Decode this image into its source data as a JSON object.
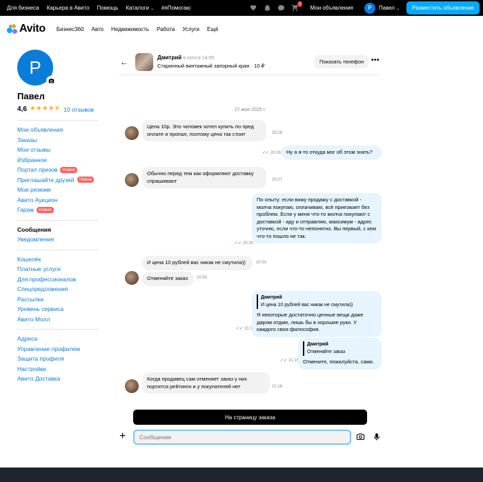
{
  "topbar": {
    "links": [
      "Для бизнеса",
      "Карьера в Авито",
      "Помощь",
      "Каталоги",
      "#яПомогаю"
    ],
    "cart_count": "2",
    "my_ads": "Мои объявления",
    "avatar_letter": "P",
    "username": "Павел",
    "post_button": "Разместить объявление"
  },
  "header": {
    "logo": "Avito",
    "nav": [
      "Бизнес360",
      "Авто",
      "Недвижимость",
      "Работа",
      "Услуги",
      "Ещё"
    ]
  },
  "profile": {
    "avatar_letter": "P",
    "name": "Павел",
    "rating": "4,6",
    "stars": "★★★★⯪",
    "reviews": "10 отзывов"
  },
  "menu_groups": [
    [
      {
        "label": "Мои объявления"
      },
      {
        "label": "Заказы"
      },
      {
        "label": "Мои отзывы"
      },
      {
        "label": "Избранное"
      },
      {
        "label": "Портал призов",
        "badge": "Новое"
      },
      {
        "label": "Приглашайте друзей",
        "badge": "Новое"
      },
      {
        "label": "Мои резюме"
      },
      {
        "label": "Авито Аукцион"
      },
      {
        "label": "Гараж",
        "badge": "Новое"
      }
    ],
    [
      {
        "label": "Сообщения",
        "active": true
      },
      {
        "label": "Уведомления"
      }
    ],
    [
      {
        "label": "Кошелёк"
      },
      {
        "label": "Платные услуги"
      },
      {
        "label": "Для профессионалов"
      },
      {
        "label": "Спецпредложения"
      },
      {
        "label": "Рассылки"
      },
      {
        "label": "Уровень сервиса"
      },
      {
        "label": "Авито Молл"
      }
    ],
    [
      {
        "label": "Адреса"
      },
      {
        "label": "Управление профилем"
      },
      {
        "label": "Защита профиля"
      },
      {
        "label": "Настройки"
      },
      {
        "label": "Авито Доставка"
      }
    ]
  ],
  "chat": {
    "contact_name": "Дмитрий",
    "online_status": "в сети в 14:05",
    "item_title": "Старинный винтажный запорный кран · 10 ₽",
    "show_phone": "Показать телефон",
    "date": "27 мая 2025 г.",
    "messages": [
      {
        "text": "Цена 10р. Это человек хотел купить по пред оплате и пропал, поэтому цена так стоит",
        "time": "18:28"
      },
      {
        "text": "Ну а я-то откуда мог об этом знать?",
        "time": "20:26"
      },
      {
        "text": "Обычно перед тем как оформляют доставку спрашивают",
        "time": "20:27"
      },
      {
        "text": "По опыту: если вижу продажу с доставкой - молча покупаю, оплачиваю, всё приезжает без проблем. Если у меня что-то молча покупают с доставкой - иду и отправляю, максимум - адрес уточню, если что-то непонятно. Вы первый, с кем что-то пошло не так.",
        "time": "20:30"
      },
      {
        "text": "И цена 10 рублей вас никак не смутила))",
        "time": "20:53"
      },
      {
        "text": "Отменяйте заказ",
        "time": "20:53"
      },
      {
        "quote_author": "Дмитрий",
        "quote_text": "И цена 10 рублей вас никак не смутила))",
        "text": "Я некоторые достаточно ценные вещи даже даром отдаю, лишь бы в хорошие руки. У каждого своя философия.",
        "time": "21:14"
      },
      {
        "quote_author": "Дмитрий",
        "quote_text": "Отменяйте заказ",
        "text": "Отмените, пожалуйста, сами.",
        "time": "21:15"
      },
      {
        "text": "Когда продавец сам отменяет заказ у них портится рейтинги и у покупателей нет",
        "time": "21:16"
      }
    ],
    "order_button": "На страницу заказа",
    "input_placeholder": "Сообщение"
  },
  "colors": {
    "brand_blue": "#0a7cd9",
    "accent": "#00aaff",
    "badge_red": "#ff6163"
  }
}
